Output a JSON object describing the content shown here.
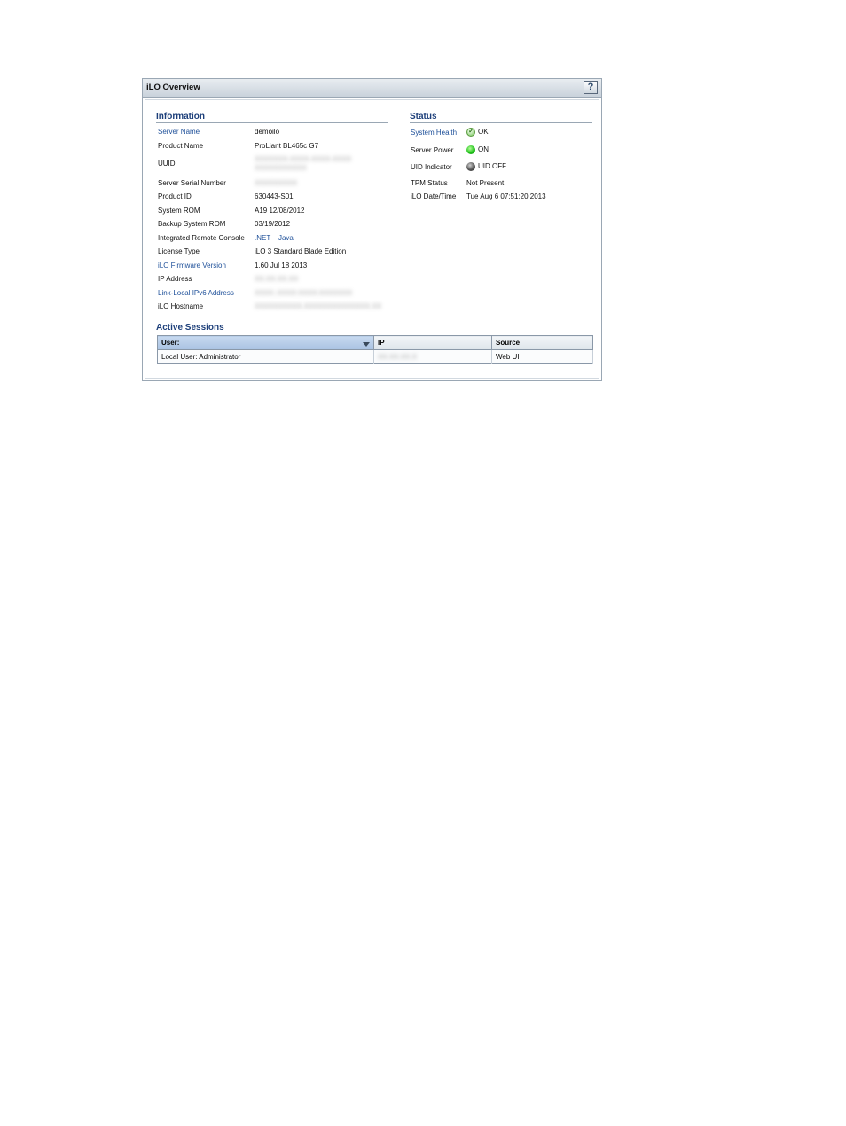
{
  "panel": {
    "title": "iLO Overview",
    "help_glyph": "?"
  },
  "information": {
    "title": "Information",
    "rows": [
      {
        "label": "Server Name",
        "value": "demoilo"
      },
      {
        "label": "Product Name",
        "value": "ProLiant BL465c G7"
      },
      {
        "label": "UUID",
        "value": "XXXXXXX-XXXX-XXXX-XXXX",
        "value2": "XXXXXXXXXXX"
      },
      {
        "label": "Server Serial Number",
        "value": "XXXXXXXXX"
      },
      {
        "label": "Product ID",
        "value": "630443-S01"
      },
      {
        "label": "System ROM",
        "value": "A19 12/08/2012"
      },
      {
        "label": "Backup System ROM",
        "value": "03/19/2012"
      },
      {
        "label": "Integrated Remote Console",
        "link1": ".NET",
        "link2": "Java"
      },
      {
        "label": "License Type",
        "value": "iLO 3 Standard Blade Edition"
      },
      {
        "label": "iLO Firmware Version",
        "value": "1.60 Jul 18 2013"
      },
      {
        "label": "IP Address",
        "value": "XX.XX.XX.XX"
      },
      {
        "label": "Link-Local IPv6 Address",
        "value": "XXXX::XXXX:XXXX:XXXXXXX"
      },
      {
        "label": "iLO Hostname",
        "value": "XXXXXXXXXX.XXXXXXXXXXXXXX.XX"
      }
    ]
  },
  "status": {
    "title": "Status",
    "rows": [
      {
        "label": "System Health",
        "value": "OK",
        "icon": "ok-check-icon"
      },
      {
        "label": "Server Power",
        "value": "ON",
        "icon": "green-led-icon"
      },
      {
        "label": "UID Indicator",
        "value": "UID OFF",
        "icon": "gray-led-icon"
      },
      {
        "label": "TPM Status",
        "value": "Not Present"
      },
      {
        "label": "iLO Date/Time",
        "value": "Tue Aug 6 07:51:20 2013"
      }
    ]
  },
  "sessions": {
    "title": "Active Sessions",
    "columns": [
      "User:",
      "IP",
      "Source"
    ],
    "rows": [
      {
        "user": "Local User: Administrator",
        "ip": "XX.XX.XX.X",
        "source": "Web UI"
      }
    ]
  },
  "colors": {
    "link": "#1d4f99",
    "section_title": "#1d3f7a",
    "border": "#9aa7b4"
  }
}
